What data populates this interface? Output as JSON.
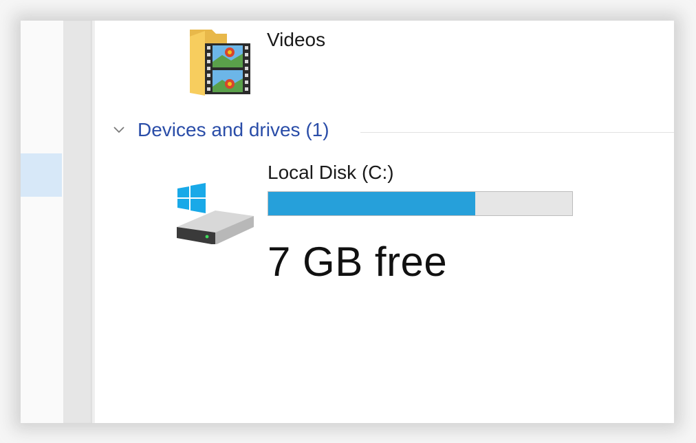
{
  "folders": [
    {
      "label": "Videos",
      "icon": "videos-folder-icon"
    }
  ],
  "group": {
    "label": "Devices and drives (1)",
    "icon": "chevron-down-icon",
    "color": "#2a4da8"
  },
  "drive": {
    "label": "Local Disk (C:)",
    "free_text": "7 GB free",
    "usage_fraction": 0.68,
    "bar_color": "#26a0da",
    "icon": "windows-drive-icon"
  },
  "colors": {
    "selection": "#d7e8f8",
    "usage_fill": "#26a0da",
    "usage_track": "#e6e6e6",
    "group_header": "#2a4da8"
  }
}
